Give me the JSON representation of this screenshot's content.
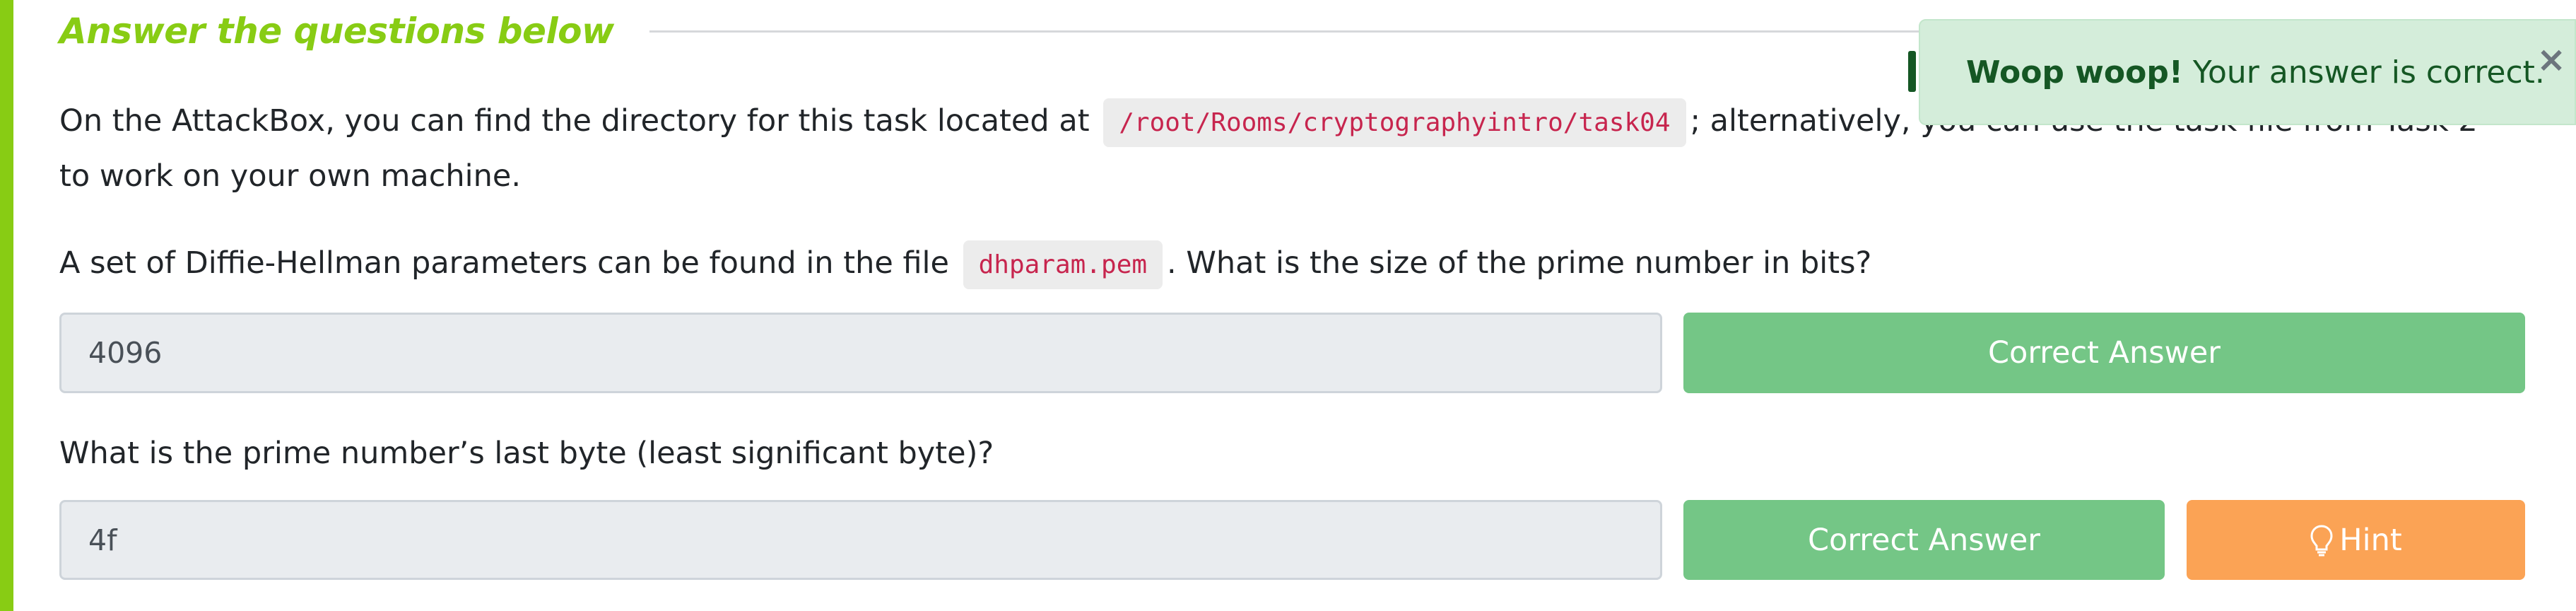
{
  "section": {
    "title": "Answer the questions below"
  },
  "intro": {
    "text_before": "On the AttackBox, you can find the directory for this task located at",
    "code": "/root/Rooms/cryptographyintro/task04",
    "text_after": "; alternatively, you can use the task file from Task 2",
    "line2": "to work on your own machine."
  },
  "question1": {
    "text_before": "A set of Diffie-Hellman parameters can be found in the file",
    "code": "dhparam.pem",
    "text_after": ". What is the size of the prime number in bits?",
    "answer_value": "4096",
    "submit_label": "Correct Answer"
  },
  "question2": {
    "text": "What is the prime number’s last byte (least significant byte)?",
    "answer_value": "4f",
    "submit_label": "Correct Answer",
    "hint_label": "Hint",
    "hint_icon": "lightbulb-icon"
  },
  "toast": {
    "strong": "Woop woop!",
    "message": "Your answer is correct.",
    "close": "×"
  },
  "colors": {
    "accent_green": "#88cc14",
    "success_button": "#74c686",
    "hint_button": "#fba355",
    "code_text": "#c7254e",
    "toast_bg": "#d4edda",
    "toast_text": "#155724"
  }
}
